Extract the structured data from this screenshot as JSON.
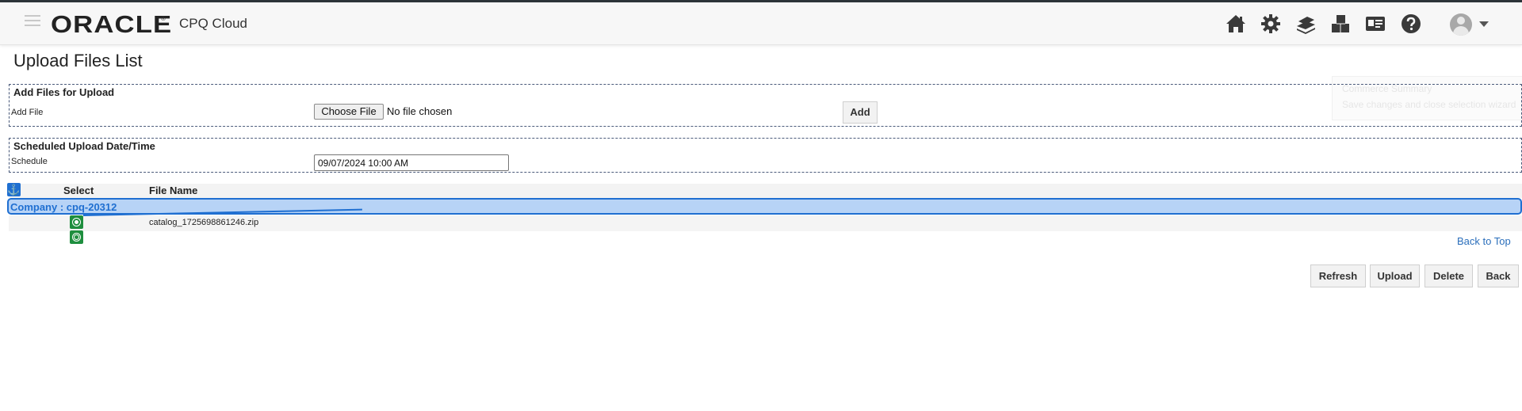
{
  "header": {
    "brand": "ORACLE",
    "brand_mark": "®",
    "product": "CPQ Cloud",
    "icons": [
      "home-icon",
      "gear-icon",
      "money-icon",
      "boxes-icon",
      "id-card-icon",
      "help-icon",
      "user-avatar-icon"
    ]
  },
  "ghost_panel": {
    "title": "Commerce Summary",
    "description": "Save changes and close selection wizard"
  },
  "page": {
    "title": "Upload Files List"
  },
  "add_files": {
    "section_title": "Add Files for Upload",
    "field_label": "Add File",
    "choose_button": "Choose File",
    "no_file_text": "No file chosen",
    "add_button": "Add"
  },
  "schedule": {
    "section_title": "Scheduled Upload Date/Time",
    "field_label": "Schedule",
    "value": "09/07/2024 10:00 AM"
  },
  "grid": {
    "anchor_glyph": "⚓",
    "columns": [
      "Select",
      "File Name"
    ],
    "group_label": "Company : cpq-20312",
    "rows": [
      {
        "file_name": "catalog_1725698861246.zip"
      }
    ]
  },
  "links": {
    "back_to_top": "Back to Top"
  },
  "actions": {
    "refresh": "Refresh",
    "upload": "Upload",
    "delete": "Delete",
    "back": "Back"
  },
  "colors": {
    "accent_blue": "#1f6fd1",
    "group_fill": "#b7d3f6",
    "select_green": "#1e8e3e",
    "link_blue": "#2a6ebb"
  }
}
